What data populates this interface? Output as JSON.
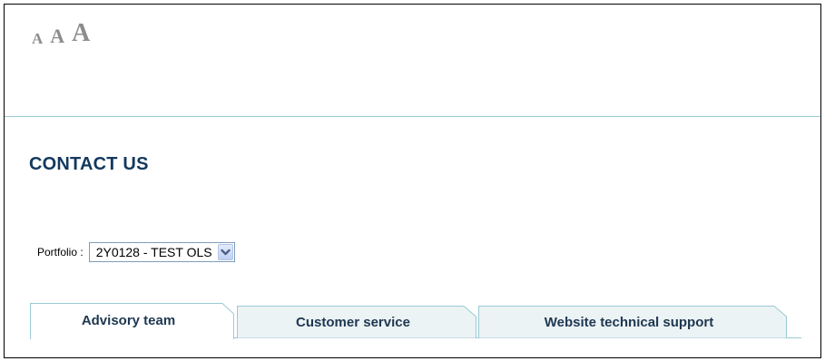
{
  "font_size_controls": {
    "small_label": "A",
    "medium_label": "A",
    "large_label": "A"
  },
  "page": {
    "title": "CONTACT US"
  },
  "portfolio": {
    "label": "Portfolio :",
    "selected_value": "2Y0128 - TEST OLS"
  },
  "tabs": [
    {
      "label": "Advisory team",
      "active": true
    },
    {
      "label": "Customer service",
      "active": false
    },
    {
      "label": "Website technical support",
      "active": false
    }
  ],
  "colors": {
    "title": "#13395e",
    "rule": "#9cc9d3",
    "tab_inactive_bg": "#ecf3f5",
    "tab_active_bg": "#ffffff",
    "font_control": "#8c8c8c"
  },
  "icons": {
    "dropdown": "chevron-down-icon"
  }
}
